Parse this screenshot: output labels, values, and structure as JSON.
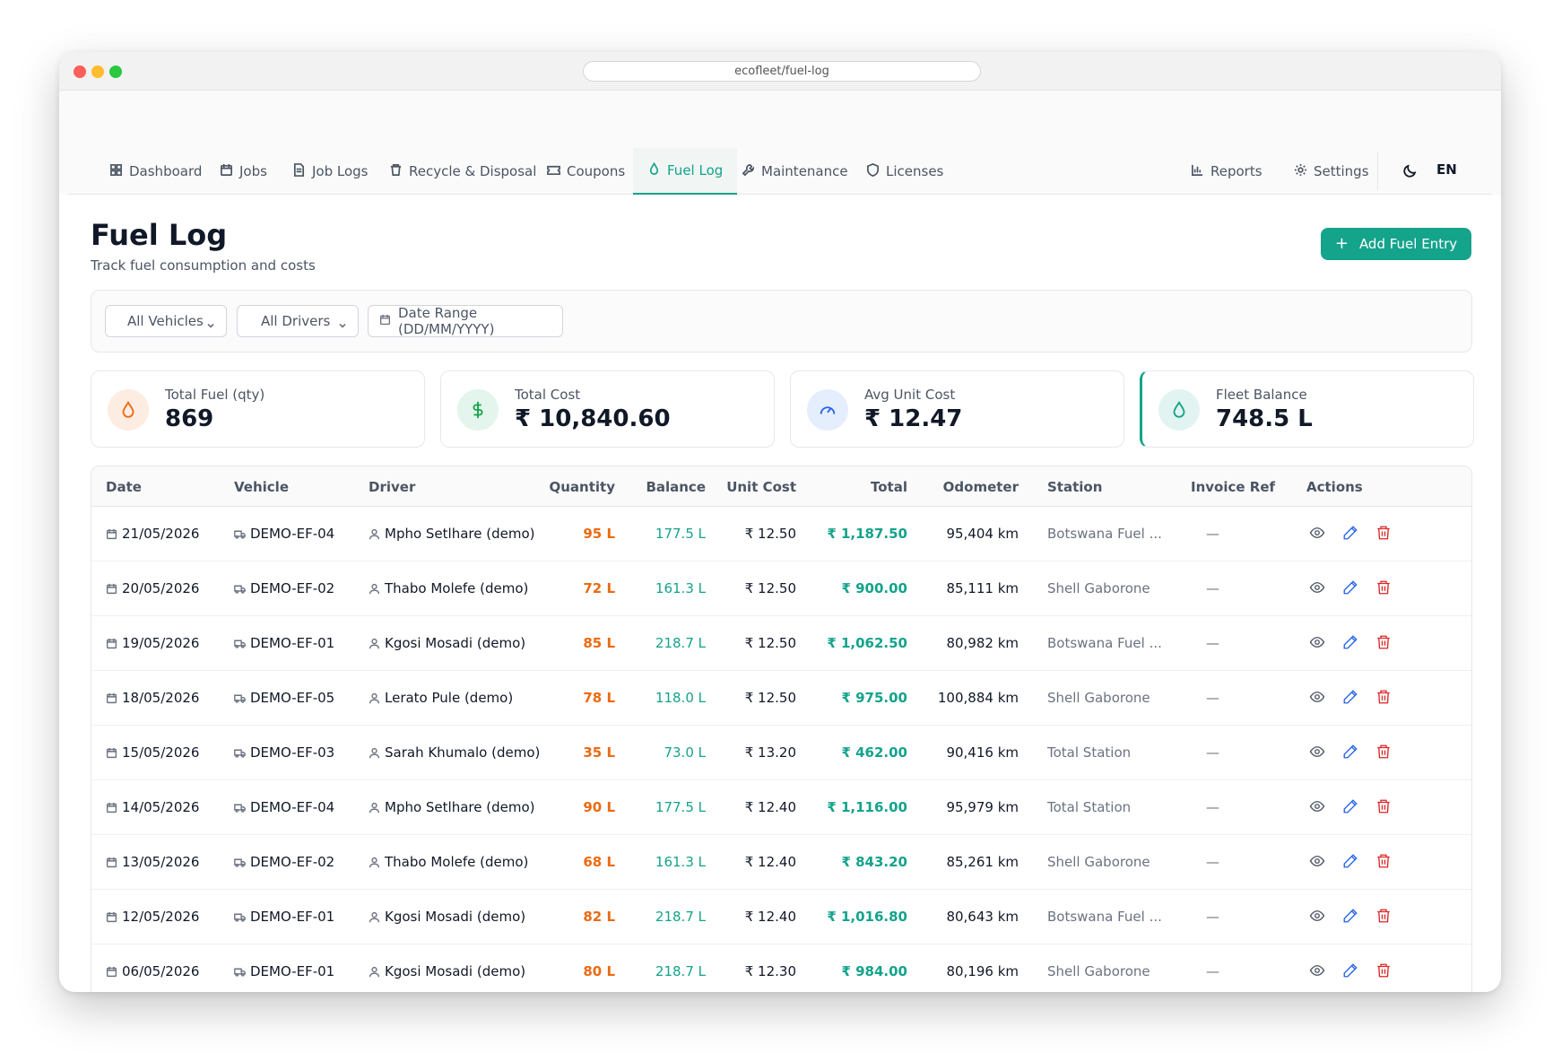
{
  "browser": {
    "url": "ecofleet/fuel-log"
  },
  "nav": {
    "items": [
      {
        "label": "Dashboard"
      },
      {
        "label": "Jobs"
      },
      {
        "label": "Job Logs"
      },
      {
        "label": "Recycle & Disposal"
      },
      {
        "label": "Coupons"
      },
      {
        "label": "Fuel Log"
      },
      {
        "label": "Maintenance"
      },
      {
        "label": "Licenses"
      },
      {
        "label": "Reports"
      },
      {
        "label": "Settings"
      }
    ],
    "active": "Fuel Log",
    "lang": "EN"
  },
  "page": {
    "title": "Fuel Log",
    "subtitle": "Track fuel consumption and costs",
    "add_button": "Add Fuel Entry"
  },
  "filters": {
    "vehicles": "All Vehicles",
    "drivers": "All Drivers",
    "date_range": "Date Range (DD/MM/YYYY)"
  },
  "stats": [
    {
      "label": "Total Fuel (qty)",
      "value": "869"
    },
    {
      "label": "Total Cost",
      "value": "₹ 10,840.60"
    },
    {
      "label": "Avg Unit Cost",
      "value": "₹ 12.47"
    },
    {
      "label": "Fleet Balance",
      "value": "748.5 L"
    }
  ],
  "colors": {
    "accent": "#14a38b",
    "quantity": "#ea6a12",
    "delete": "#dc2626",
    "edit": "#2563eb"
  },
  "table": {
    "headers": [
      "Date",
      "Vehicle",
      "Driver",
      "Quantity",
      "Balance",
      "Unit Cost",
      "Total",
      "Odometer",
      "Station",
      "Invoice Ref",
      "Actions"
    ],
    "rows": [
      {
        "date": "21/05/2026",
        "vehicle": "DEMO-EF-04",
        "driver": "Mpho Setlhare (demo)",
        "qty": "95 L",
        "balance": "177.5 L",
        "unit": "₹ 12.50",
        "total": "₹ 1,187.50",
        "odo": "95,404 km",
        "station": "Botswana Fuel ...",
        "invoice": "—"
      },
      {
        "date": "20/05/2026",
        "vehicle": "DEMO-EF-02",
        "driver": "Thabo Molefe (demo)",
        "qty": "72 L",
        "balance": "161.3 L",
        "unit": "₹ 12.50",
        "total": "₹ 900.00",
        "odo": "85,111 km",
        "station": "Shell Gaborone",
        "invoice": "—"
      },
      {
        "date": "19/05/2026",
        "vehicle": "DEMO-EF-01",
        "driver": "Kgosi Mosadi (demo)",
        "qty": "85 L",
        "balance": "218.7 L",
        "unit": "₹ 12.50",
        "total": "₹ 1,062.50",
        "odo": "80,982 km",
        "station": "Botswana Fuel ...",
        "invoice": "—"
      },
      {
        "date": "18/05/2026",
        "vehicle": "DEMO-EF-05",
        "driver": "Lerato Pule (demo)",
        "qty": "78 L",
        "balance": "118.0 L",
        "unit": "₹ 12.50",
        "total": "₹ 975.00",
        "odo": "100,884 km",
        "station": "Shell Gaborone",
        "invoice": "—"
      },
      {
        "date": "15/05/2026",
        "vehicle": "DEMO-EF-03",
        "driver": "Sarah Khumalo (demo)",
        "qty": "35 L",
        "balance": "73.0 L",
        "unit": "₹ 13.20",
        "total": "₹ 462.00",
        "odo": "90,416 km",
        "station": "Total Station",
        "invoice": "—"
      },
      {
        "date": "14/05/2026",
        "vehicle": "DEMO-EF-04",
        "driver": "Mpho Setlhare (demo)",
        "qty": "90 L",
        "balance": "177.5 L",
        "unit": "₹ 12.40",
        "total": "₹ 1,116.00",
        "odo": "95,979 km",
        "station": "Total Station",
        "invoice": "—"
      },
      {
        "date": "13/05/2026",
        "vehicle": "DEMO-EF-02",
        "driver": "Thabo Molefe (demo)",
        "qty": "68 L",
        "balance": "161.3 L",
        "unit": "₹ 12.40",
        "total": "₹ 843.20",
        "odo": "85,261 km",
        "station": "Shell Gaborone",
        "invoice": "—"
      },
      {
        "date": "12/05/2026",
        "vehicle": "DEMO-EF-01",
        "driver": "Kgosi Mosadi (demo)",
        "qty": "82 L",
        "balance": "218.7 L",
        "unit": "₹ 12.40",
        "total": "₹ 1,016.80",
        "odo": "80,643 km",
        "station": "Botswana Fuel ...",
        "invoice": "—"
      },
      {
        "date": "06/05/2026",
        "vehicle": "DEMO-EF-01",
        "driver": "Kgosi Mosadi (demo)",
        "qty": "80 L",
        "balance": "218.7 L",
        "unit": "₹ 12.30",
        "total": "₹ 984.00",
        "odo": "80,196 km",
        "station": "Shell Gaborone",
        "invoice": "—"
      }
    ]
  }
}
